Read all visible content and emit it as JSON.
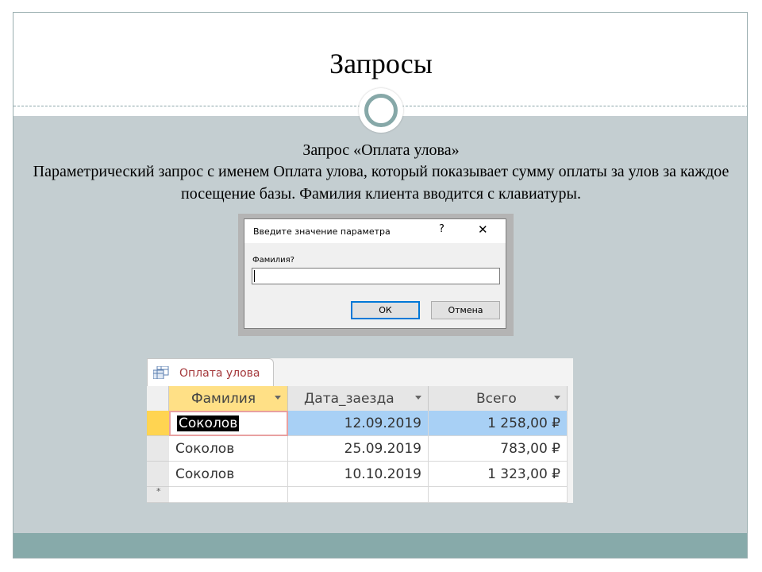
{
  "slide": {
    "title": "Запросы",
    "subtitle": "Запрос «Оплата улова»",
    "description": "Параметрический запрос с именем Оплата улова, который показывает сумму оплаты за улов за каждое посещение базы. Фамилия клиента вводится с клавиатуры."
  },
  "dialog": {
    "title": "Введите значение параметра",
    "help": "?",
    "close": "✕",
    "label": "Фамилия?",
    "input_value": "",
    "ok_label": "ОК",
    "cancel_label": "Отмена"
  },
  "table": {
    "tab_label": "Оплата улова",
    "tab_icon": "query-icon",
    "columns": [
      "Фамилия",
      "Дата_заезда",
      "Всего"
    ],
    "rows": [
      [
        "Соколов",
        "12.09.2019",
        "1 258,00 ₽"
      ],
      [
        "Соколов",
        "25.09.2019",
        "783,00 ₽"
      ],
      [
        "Соколов",
        "10.10.2019",
        "1 323,00 ₽"
      ]
    ],
    "new_row_marker": "*"
  },
  "colors": {
    "accent": "#86a8a8",
    "content_bg": "#c4ced1",
    "selected_header": "#ffe086",
    "row_highlight": "#a8d0f5",
    "tab_text": "#a4373a"
  }
}
